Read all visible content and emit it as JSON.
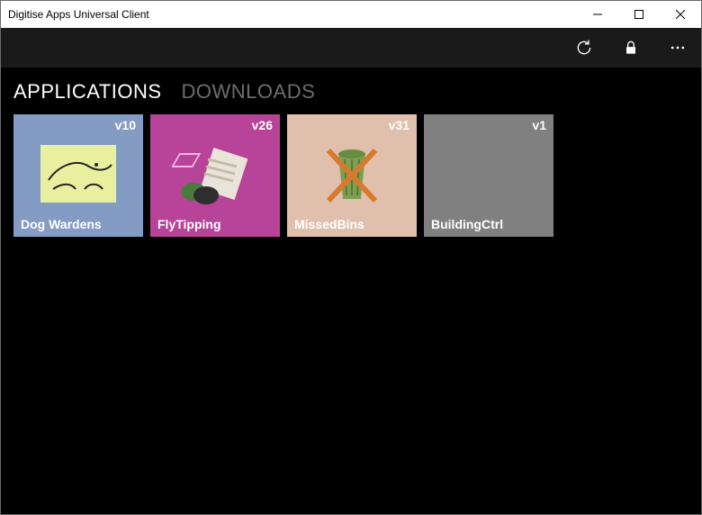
{
  "window": {
    "title": "Digitise Apps Universal Client"
  },
  "chrome": {
    "refresh": "refresh",
    "lock": "lock",
    "more": "more"
  },
  "tabs": {
    "applications": "APPLICATIONS",
    "downloads": "DOWNLOADS"
  },
  "tiles": [
    {
      "name": "Dog Wardens",
      "version": "v10",
      "bg": "#849bc4"
    },
    {
      "name": "FlyTipping",
      "version": "v26",
      "bg": "#b74499"
    },
    {
      "name": "MissedBins",
      "version": "v31",
      "bg": "#e1bfad"
    },
    {
      "name": "BuildingCtrl",
      "version": "v1",
      "bg": "#808080"
    }
  ]
}
